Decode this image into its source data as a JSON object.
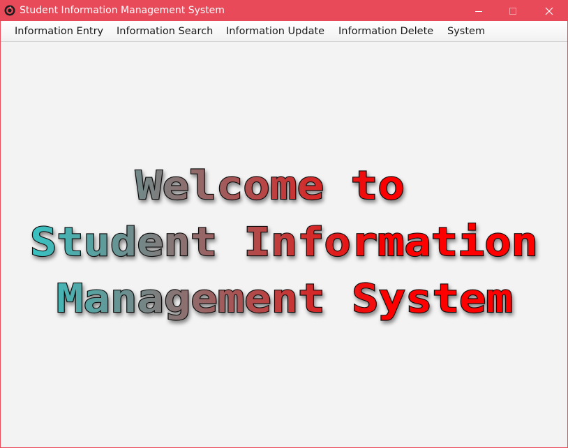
{
  "window": {
    "title": "Student Information Management System",
    "accent_color": "#e84a5a",
    "controls": {
      "minimize_icon": "minimize-icon",
      "maximize_icon": "maximize-icon",
      "close_icon": "close-icon"
    }
  },
  "menubar": {
    "items": [
      {
        "label": "Information Entry"
      },
      {
        "label": "Information Search"
      },
      {
        "label": "Information Update"
      },
      {
        "label": "Information Delete"
      },
      {
        "label": "System"
      }
    ]
  },
  "welcome": {
    "lines": [
      "Welcome to",
      "Student Information",
      "Management System"
    ],
    "gradient_colors": [
      "#36c4c4",
      "#ff0000"
    ],
    "outline_color": "#111111"
  }
}
